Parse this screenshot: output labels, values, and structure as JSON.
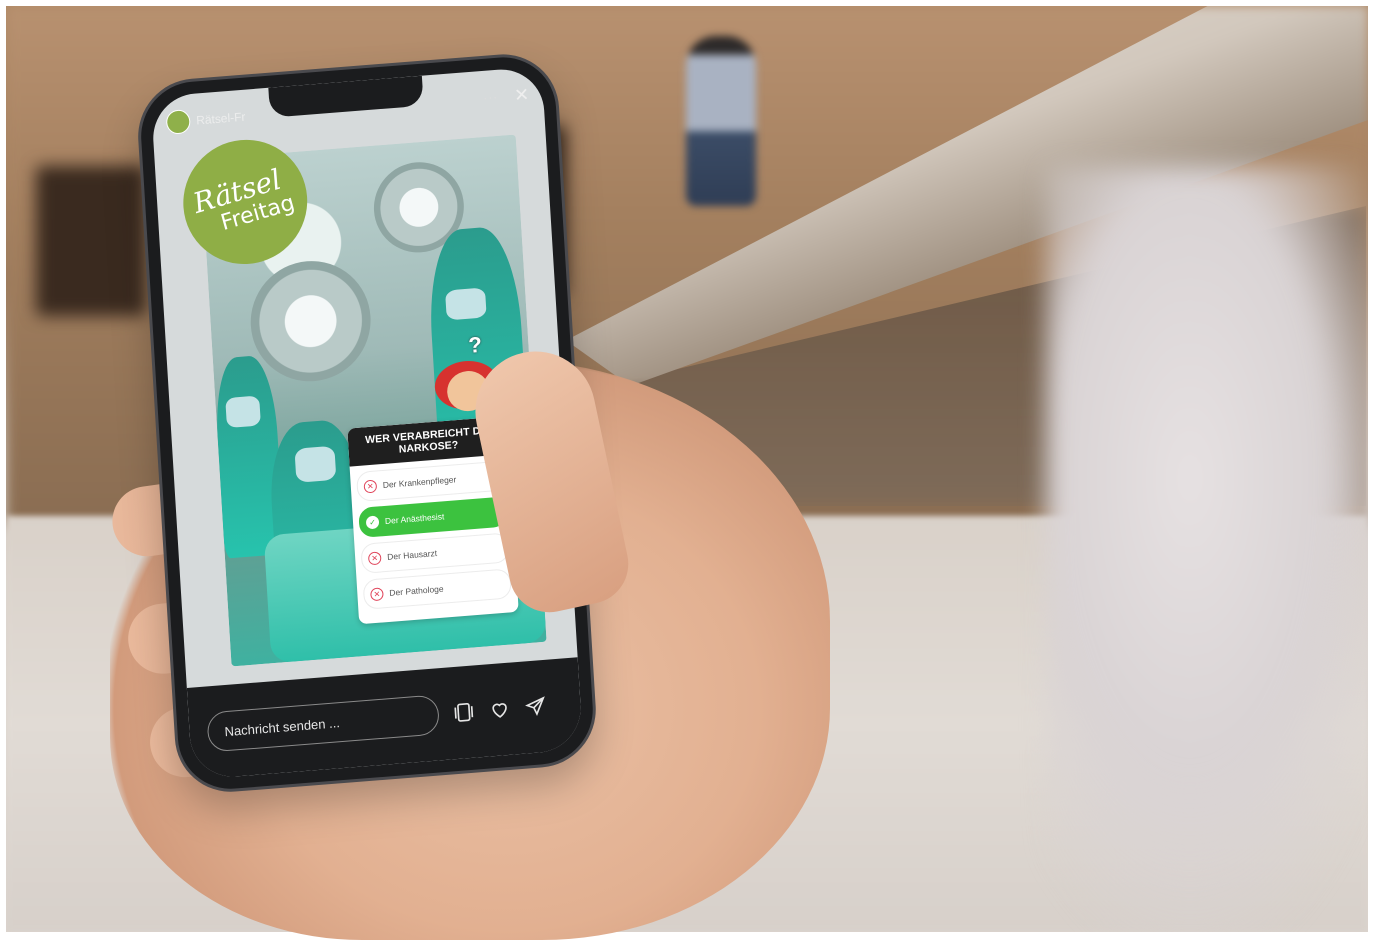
{
  "story": {
    "account_title": "Rätsel-Fr",
    "more": "···",
    "close": "✕"
  },
  "sticker": {
    "line1": "Rätsel",
    "line2": "Freitag",
    "color": "#8fae46"
  },
  "quiz": {
    "question": "WER VERABREICHT DIE NARKOSE?",
    "question_mark": "?",
    "options": [
      {
        "label": "Der Krankenpfleger",
        "state": "wrong"
      },
      {
        "label": "Der Anästhesist",
        "state": "correct"
      },
      {
        "label": "Der Hausarzt",
        "state": "wrong"
      },
      {
        "label": "Der Pathologe",
        "state": "wrong"
      }
    ],
    "correct_color": "#3cc23f",
    "wrong_color": "#e0445a"
  },
  "bottom_bar": {
    "message_placeholder": "Nachricht senden ...",
    "icons": [
      "stories-icon",
      "heart-icon",
      "send-icon"
    ]
  }
}
